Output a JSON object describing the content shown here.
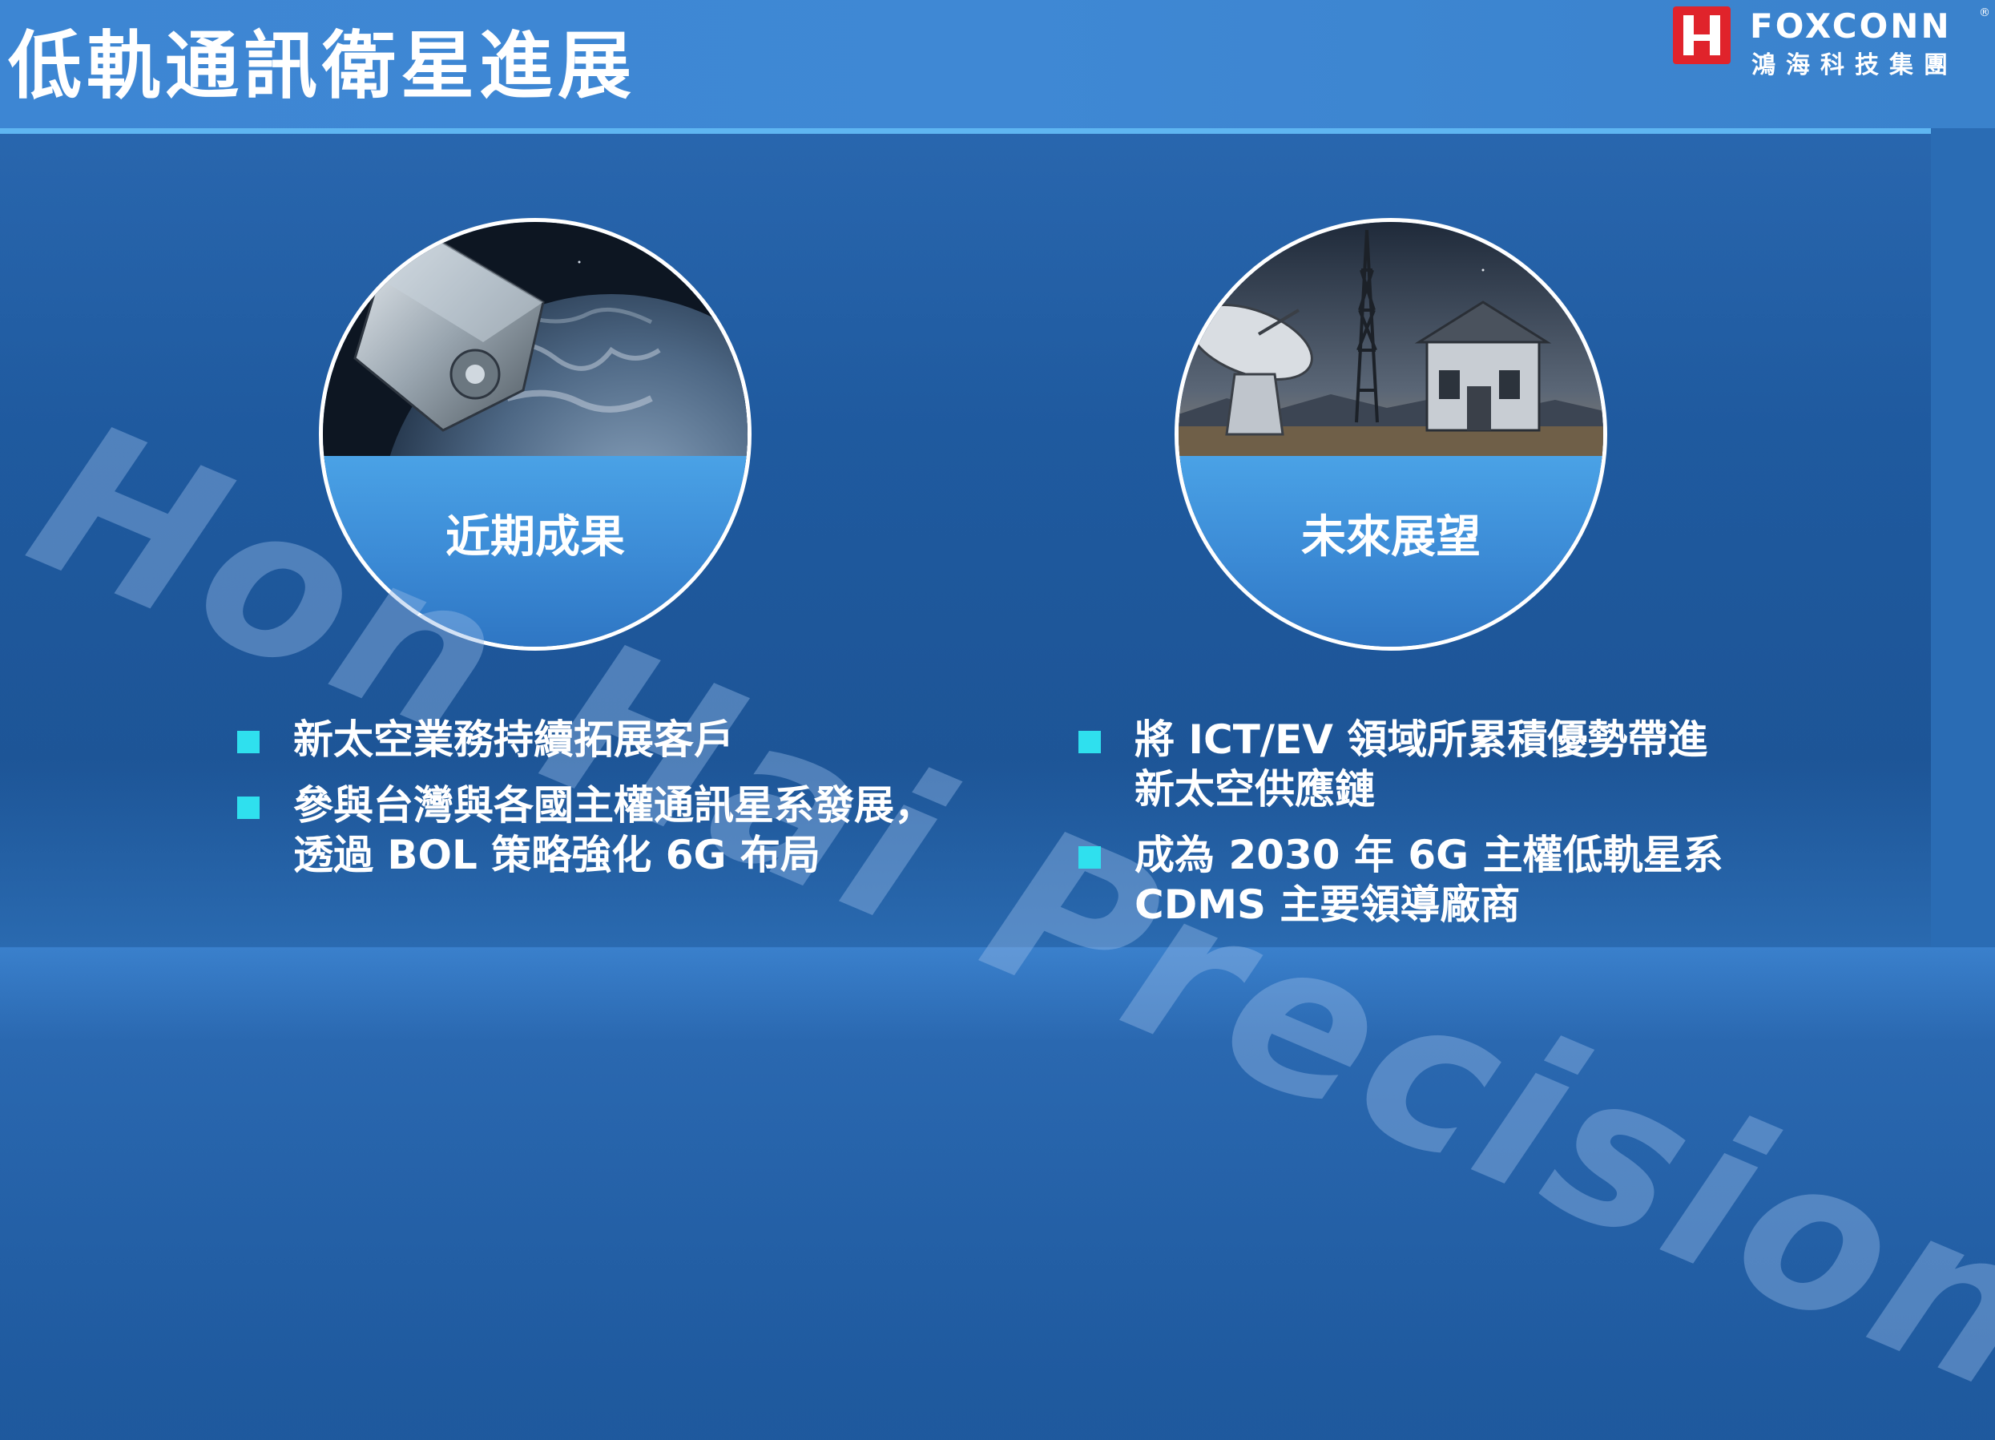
{
  "slide": {
    "title": "低軌通訊衛星進展"
  },
  "logo": {
    "brand": "FOXCONN",
    "registered": "®",
    "chinese_name": "鴻海科技集團",
    "mark_color": "#e0232b"
  },
  "watermark": {
    "text": "Hon Hai Precision"
  },
  "circles": [
    {
      "label": "近期成果",
      "image": "satellite-over-earth"
    },
    {
      "label": "未來展望",
      "image": "ground-station-dish-tower-house"
    }
  ],
  "bullets_left": [
    {
      "lines": [
        "新太空業務持續拓展客戶"
      ]
    },
    {
      "lines": [
        "參與台灣與各國主權通訊星系發展，",
        "透過 BOL 策略強化 6G 布局"
      ]
    }
  ],
  "bullets_right": [
    {
      "lines": [
        "將 ICT/EV 領域所累積優勢帶進",
        "新太空供應鏈"
      ]
    },
    {
      "lines": [
        "成為 2030 年 6G 主權低軌星系",
        "CDMS 主要領導廠商"
      ]
    }
  ],
  "colors": {
    "background": "#1f5a9f",
    "accent_rule": "#5fb6f2",
    "bullet_square": "#2fe0ee",
    "circle_fill": "#3b8ad5"
  }
}
